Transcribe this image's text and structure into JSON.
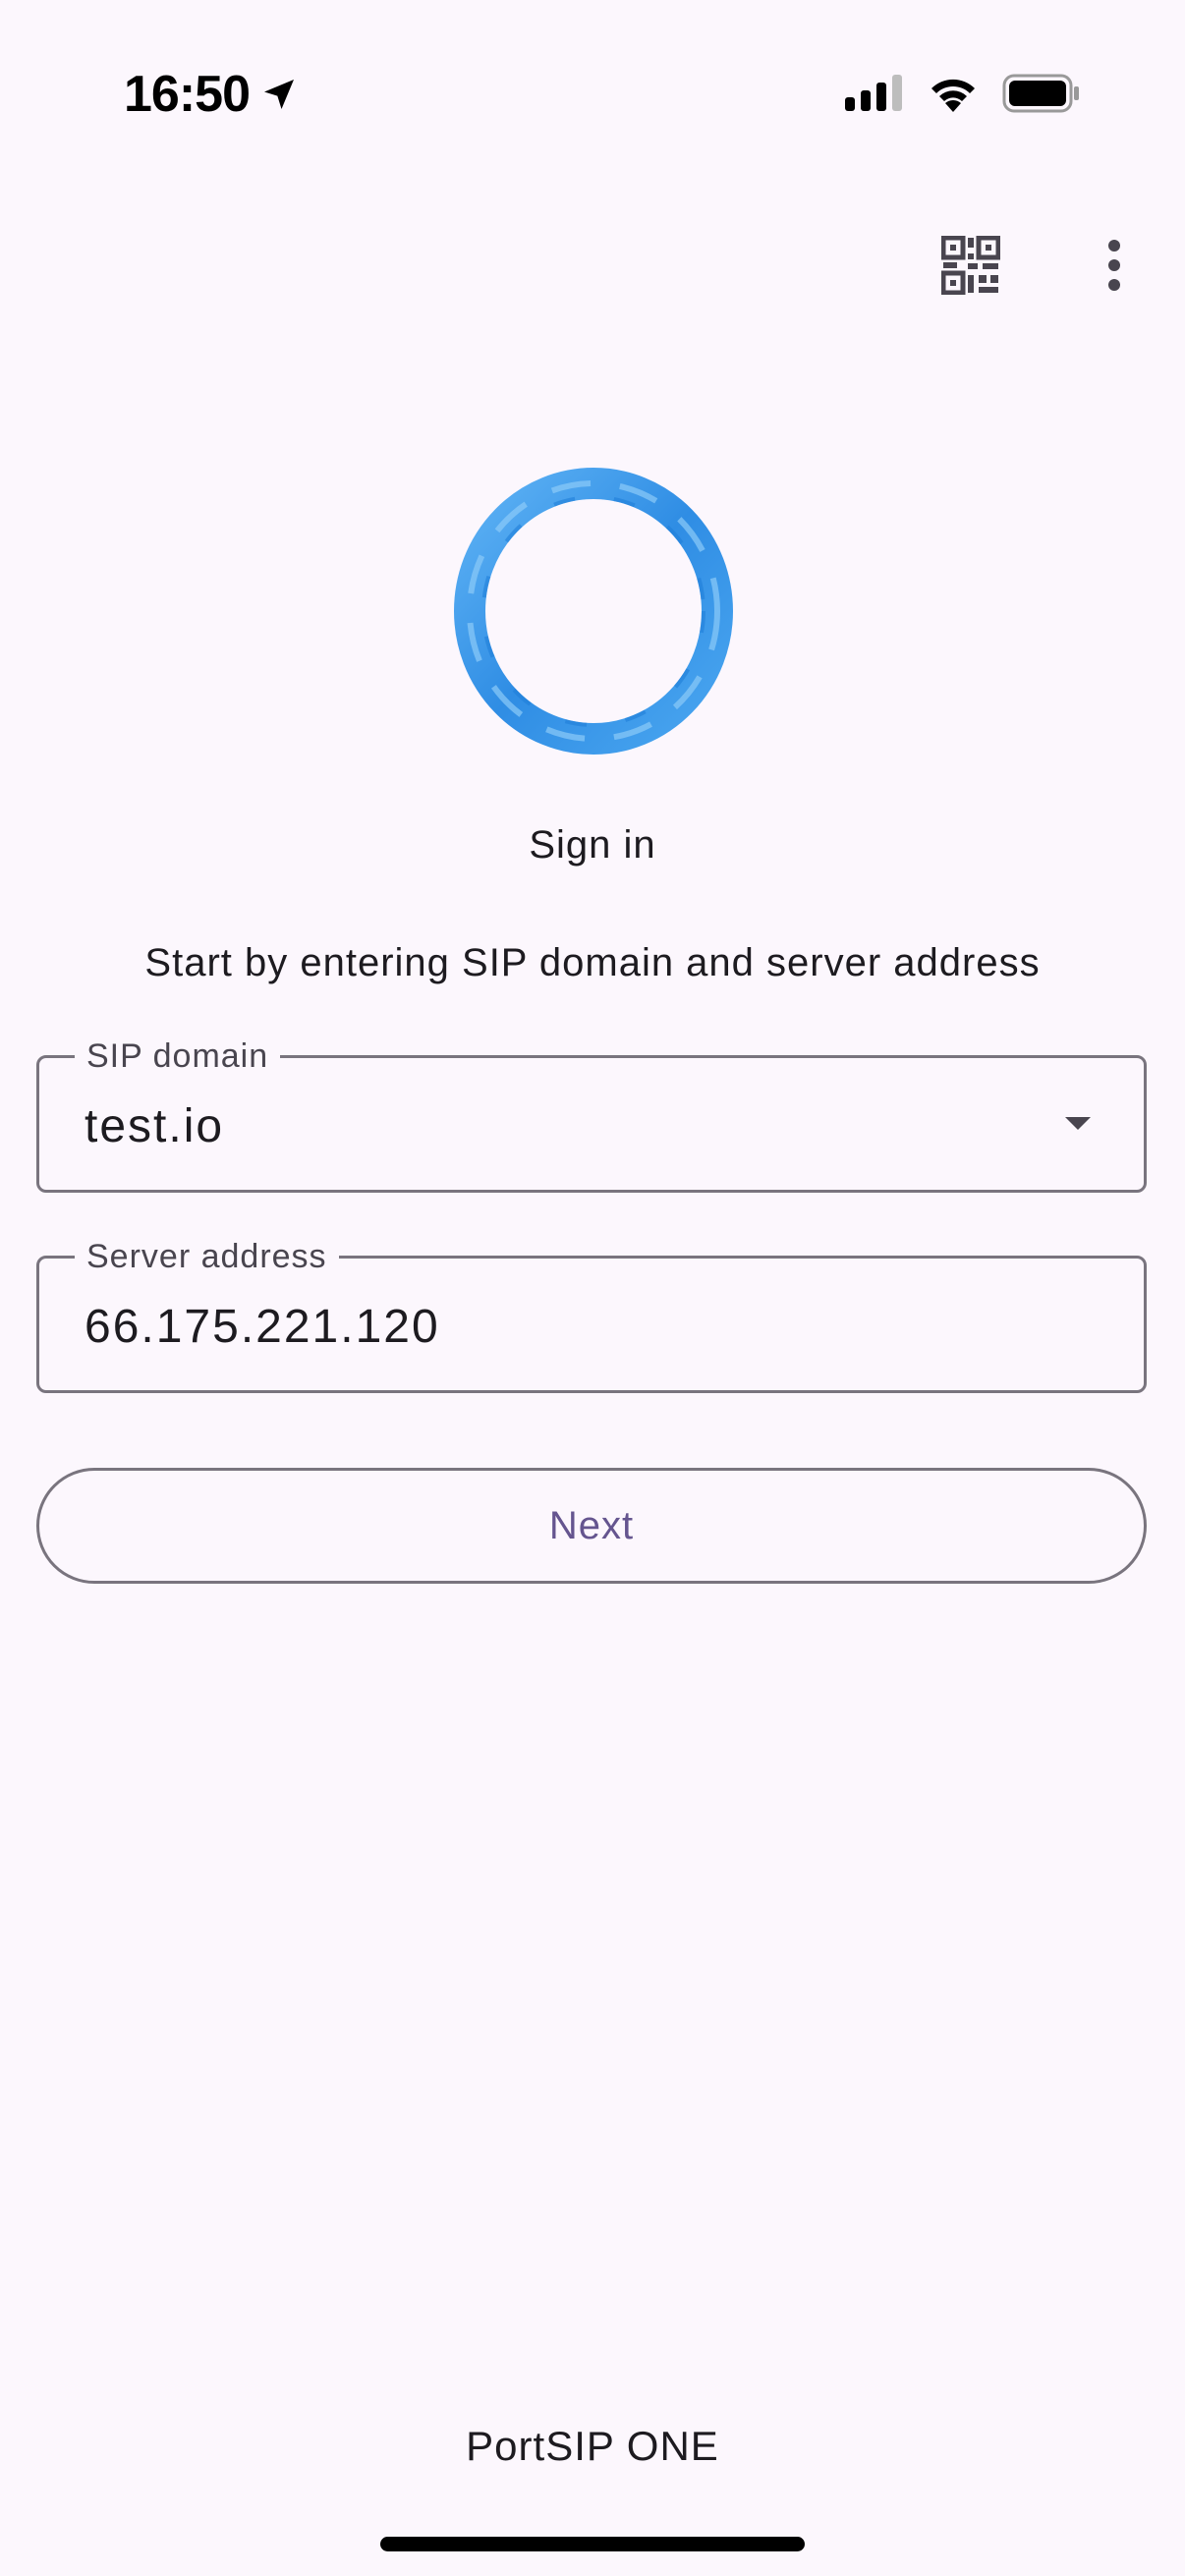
{
  "status_bar": {
    "time": "16:50",
    "icons": [
      "location-arrow-icon",
      "cellular-signal-icon",
      "wifi-icon",
      "battery-icon"
    ]
  },
  "top_actions": {
    "qr_icon": "qr-code-icon",
    "more_icon": "more-vertical-icon"
  },
  "logo": {
    "icon": "portsip-ring-logo",
    "color": "#3a95e8"
  },
  "title": "Sign in",
  "subtitle": "Start by entering SIP domain and server address",
  "sip_domain": {
    "label": "SIP domain",
    "value": "test.io"
  },
  "server_address": {
    "label": "Server address",
    "value": "66.175.221.120"
  },
  "next_button": {
    "label": "Next"
  },
  "footer": "PortSIP ONE",
  "colors": {
    "background": "#fcf7fd",
    "outline": "#79747e",
    "primary_text": "#65558f"
  }
}
